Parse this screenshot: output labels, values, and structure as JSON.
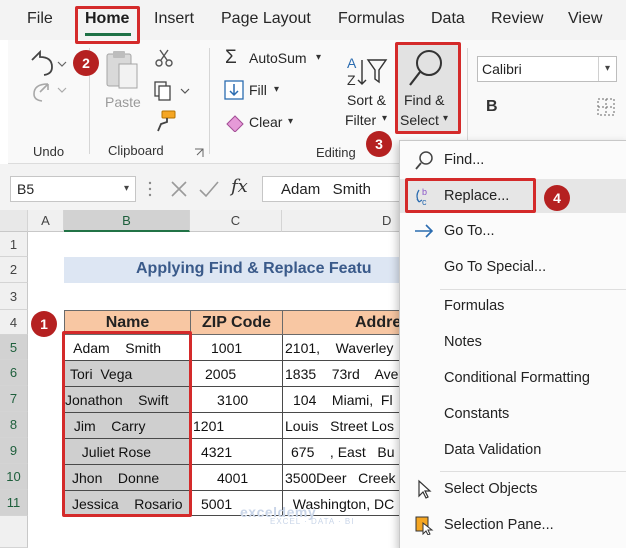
{
  "menu": {
    "tabs": [
      {
        "label": "File"
      },
      {
        "label": "Home"
      },
      {
        "label": "Insert"
      },
      {
        "label": "Page Layout"
      },
      {
        "label": "Formulas"
      },
      {
        "label": "Data"
      },
      {
        "label": "Review"
      },
      {
        "label": "View"
      }
    ],
    "active_tab": "Home"
  },
  "ribbon": {
    "undo_group": "Undo",
    "clipboard": {
      "paste": "Paste",
      "label": "Clipboard"
    },
    "editing": {
      "autosum": "AutoSum",
      "fill": "Fill",
      "clear": "Clear",
      "sort_filter_line1": "Sort &",
      "sort_filter_line2": "Filter",
      "find_select_line1": "Find &",
      "find_select_line2": "Select",
      "label": "Editing"
    },
    "font": {
      "name": "Calibri",
      "bold": "B"
    }
  },
  "formula_bar": {
    "name_box": "B5",
    "fx": "fx",
    "value": "Adam   Smith"
  },
  "sheet": {
    "columns": [
      "A",
      "B",
      "C",
      "D"
    ],
    "selected_column": "B",
    "rows": [
      "1",
      "2",
      "3",
      "4",
      "5",
      "6",
      "7",
      "8",
      "9",
      "10",
      "11"
    ],
    "title": "Applying Find & Replace Featu",
    "headers": {
      "name": "Name",
      "zip": "ZIP Code",
      "address": "Addre"
    },
    "data": [
      {
        "name": " Adam    Smith",
        "zip": "1001",
        "address": "2101,    Waverley"
      },
      {
        "name": "Tori  Vega",
        "zip": "2005",
        "address": "1835    73rd    Ave"
      },
      {
        "name": "Jonathon    Swift",
        "zip": "3100",
        "address": "104    Miami,  Fl"
      },
      {
        "name": " Jim    Carry",
        "zip": "1201",
        "address": "Louis   Street Los"
      },
      {
        "name": "  Juliet Rose",
        "zip": "4321",
        "address": "675    , East   Bu"
      },
      {
        "name": "Jhon    Donne",
        "zip": "4001",
        "address": "3500Deer   Creek"
      },
      {
        "name": "Jessica    Rosario",
        "zip": "5001",
        "address": "  Washington, DC"
      }
    ]
  },
  "dropdown": {
    "items": [
      {
        "label": "Find...",
        "icon": "find-icon"
      },
      {
        "label": "Replace...",
        "icon": "replace-icon"
      },
      {
        "label": "Go To...",
        "icon": "goto-arrow-icon"
      },
      {
        "label": "Go To Special...",
        "icon": ""
      },
      {
        "label": "Formulas",
        "icon": ""
      },
      {
        "label": "Notes",
        "icon": ""
      },
      {
        "label": "Conditional Formatting",
        "icon": ""
      },
      {
        "label": "Constants",
        "icon": ""
      },
      {
        "label": "Data Validation",
        "icon": ""
      },
      {
        "label": "Select Objects",
        "icon": "cursor-icon"
      },
      {
        "label": "Selection Pane...",
        "icon": "selection-pane-icon"
      }
    ]
  },
  "callouts": [
    "1",
    "2",
    "3",
    "4"
  ],
  "watermark": {
    "brand": "exceldemy",
    "tagline": "EXCEL · DATA · BI"
  },
  "colors": {
    "accent_green": "#217346",
    "callout_red": "#d42a2a",
    "header_fill": "#f8c7a3",
    "title_fill": "#dde6f3"
  }
}
